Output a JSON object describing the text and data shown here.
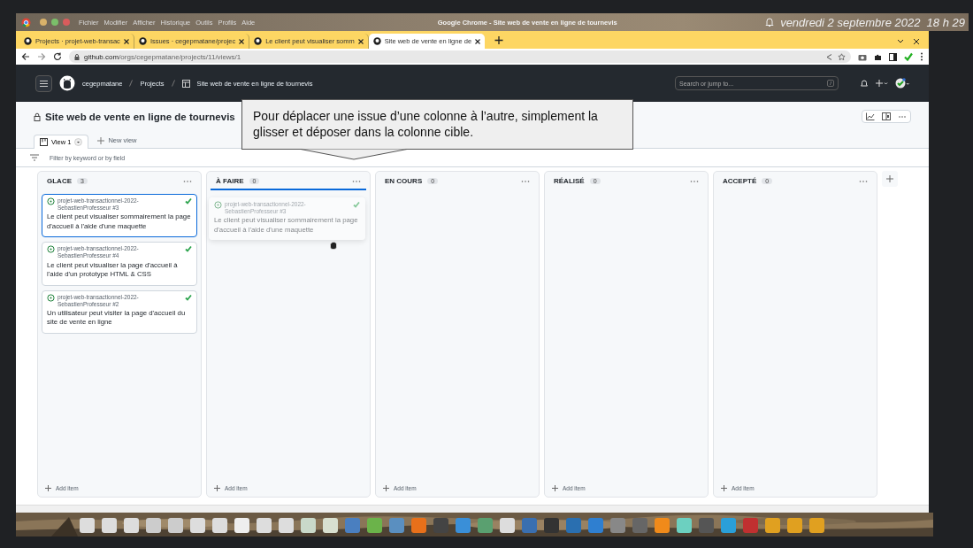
{
  "desktop_bar": {
    "menu": [
      "Fichier",
      "Modifier",
      "Afficher",
      "Historique",
      "Outils",
      "Profils",
      "Aide"
    ],
    "title": "Google Chrome - Site web de vente en ligne de tournevis",
    "clock": "vendredi 2 septembre 2022  18 h 29"
  },
  "browser": {
    "tabs": [
      {
        "label": "Projects · projet-web-transac",
        "selected": false
      },
      {
        "label": "Issues · cegepmatane/projec",
        "selected": false
      },
      {
        "label": "Le client peut visualiser somm",
        "selected": false
      },
      {
        "label": "Site web de vente en ligne de",
        "selected": true
      }
    ],
    "url_host": "github.com",
    "url_path": "/orgs/cegepmatane/projects/11/views/1"
  },
  "github": {
    "breadcrumbs": [
      "cegepmatane",
      "Projects",
      "Site web de vente en ligne de tournevis"
    ],
    "search": {
      "placeholder": "Search or jump to...",
      "shortcut": "/"
    }
  },
  "project": {
    "title": "Site web de vente en ligne de tournevis",
    "views": [
      {
        "label": "View 1",
        "selected": true
      }
    ],
    "new_view": "New view",
    "filter": {
      "placeholder": "Filter by keyword or by field"
    }
  },
  "columns": [
    {
      "name": "GLACE",
      "count": "3",
      "drop_target": false,
      "add_item": "Add item",
      "cards": [
        {
          "repo": "projet-web-transactionnel-2022-SebastienProfesseur #3",
          "title": "Le client peut visualiser sommairement la page d'accueil à l'aide d'une maquette",
          "selected": true
        },
        {
          "repo": "projet-web-transactionnel-2022-SebastienProfesseur #4",
          "title": "Le client peut visualiser la page d'accueil à l'aide d'un prototype HTML & CSS",
          "selected": false
        },
        {
          "repo": "projet-web-transactionnel-2022-SebastienProfesseur #2",
          "title": "Un utilisateur peut visiter la page d'accueil du site de vente en ligne",
          "selected": false
        }
      ]
    },
    {
      "name": "À FAIRE",
      "count": "0",
      "drop_target": true,
      "add_item": "Add item"
    },
    {
      "name": "EN COURS",
      "count": "0",
      "drop_target": false,
      "add_item": "Add item"
    },
    {
      "name": "RÉALISÉ",
      "count": "0",
      "drop_target": false,
      "add_item": "Add item"
    },
    {
      "name": "ACCEPTÉ",
      "count": "0",
      "drop_target": false,
      "add_item": "Add item"
    }
  ],
  "drag_card": {
    "repo": "projet-web-transactionnel-2022-SebastienProfesseur #3",
    "title": "Le client peut visualiser sommairement la page d'accueil à l'aide d'une maquette"
  },
  "callout": "Pour déplacer une issue d’une colonne à l’autre, simplement la glisser et déposer dans la colonne cible."
}
